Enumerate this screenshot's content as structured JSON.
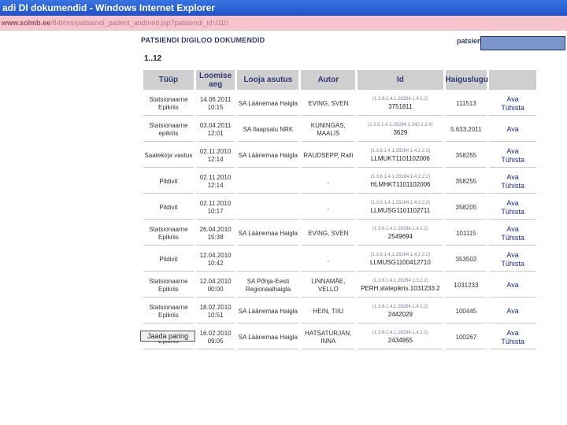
{
  "window": {
    "title": "adi DI dokumendid - Windows Internet Explorer",
    "address_host": "www.solmb.ee",
    "address_path": "/84t/ors/patsiendi_patient_andmed.jsp?patsiendi_id=010"
  },
  "page": {
    "title": "PATSIENDI DIGILOO DOKUMENDID",
    "patient_label": "patsient",
    "range": "1..12",
    "more_button": "Jaada paring"
  },
  "table": {
    "headers": [
      "Tüüp",
      "Loomise aeg",
      "Looja asutus",
      "Autor",
      "Id",
      "Haiguslugu",
      ""
    ],
    "rows": [
      {
        "type": "Statsionaarne Epikriis",
        "date": "14.06.2011",
        "time": "10:15",
        "org": "SA Läänemaa Haigla",
        "author": "EVING, SVEN",
        "id_oid": "(1.3.6.1.4.1.28284.1.4.2.2)",
        "id": "3751811",
        "case": "111513",
        "actions": [
          "Ava",
          "Tühista"
        ]
      },
      {
        "type": "Statsionaarne epikriis",
        "date": "03.04.2011",
        "time": "12:01",
        "org": "SA Ilaapsalu NRK",
        "author": "KUNINGAS, MAALIS",
        "id_oid": "(1.3.6.1.4.1.28284.1.240.2.2.4)",
        "id": "3629",
        "case": "5.633.2011",
        "actions": [
          "Ava"
        ]
      },
      {
        "type": "Saatekirja vastus",
        "date": "02.11.2010",
        "time": "12:14",
        "org": "SA Läänemaa Haigla",
        "author": "RAUDSEPP, Raili",
        "id_oid": "(1.3.6.1.4.1.28284.1.4.2.2.2)",
        "id": "LLMUKT1101102006",
        "case": "358255",
        "actions": [
          "Ava",
          "Tühista"
        ]
      },
      {
        "type": "Pildivit",
        "date": "02.11.2010",
        "time": "12:14",
        "org": "",
        "author": ",",
        "id_oid": "(1.3.6.1.4.1.28284.1.4.2.2.2)",
        "id": "HLMHKT1101102006",
        "case": "358255",
        "actions": [
          "Ava",
          "Tühista"
        ]
      },
      {
        "type": "Pildivit",
        "date": "02.11.2010",
        "time": "10:17",
        "org": "",
        "author": ",",
        "id_oid": "(1.3.6.1.4.1.28284.1.4.2.2.2)",
        "id": "LLMUSG1101102711",
        "case": "358205",
        "actions": [
          "Ava",
          "Tühista"
        ]
      },
      {
        "type": "Statsionaarne Epikriis",
        "date": "26.04.2010",
        "time": "15:38",
        "org": "SA Läänemaa Haigla",
        "author": "EVING, SVEN",
        "id_oid": "(1.3.6.1.4.1.28284.1.4.2.2)",
        "id": "2549694",
        "case": "101115",
        "actions": [
          "Ava",
          "Tühista"
        ]
      },
      {
        "type": "Pildivit",
        "date": "12.04.2010",
        "time": "10:42",
        "org": "",
        "author": ",",
        "id_oid": "(1.3.6.1.4.1.28284.1.4.2.2.2)",
        "id": "LLMUSG1100412710",
        "case": "353503",
        "actions": [
          "Ava",
          "Tühista"
        ]
      },
      {
        "type": "Statsionaarne Epikriis",
        "date": "12.04.2010",
        "time": "00:00",
        "org": "SA Põhja-Eesti Regionaalhaigla",
        "author": "LINNAMÄE, VELLO",
        "id_oid": "(1.3.6.1.4.1.28284.1.3.2.2)",
        "id": "PERH.statepikris.1031233.2",
        "case": "1031233",
        "actions": [
          "Ava"
        ]
      },
      {
        "type": "Statsionaarne Epikriis",
        "date": "18.02.2010",
        "time": "10:51",
        "org": "SA Läänemaa Haigla",
        "author": "HEIN, TIIU",
        "id_oid": "(1.3.6.1.4.1.28284.1.4.2.2)",
        "id": "2442029",
        "case": "100445",
        "actions": [
          "Ava"
        ]
      },
      {
        "type": "Statsionaarne Epikriis",
        "date": "16.02.2010",
        "time": "09:05",
        "org": "SA Läänemaa Haigla",
        "author": "HATSATURJAN, INNA",
        "id_oid": "(1.3.6.1.4.1.28284.1.4.2.2)",
        "id": "2434955",
        "case": "100267",
        "actions": [
          "Ava",
          "Tühista"
        ]
      }
    ]
  }
}
